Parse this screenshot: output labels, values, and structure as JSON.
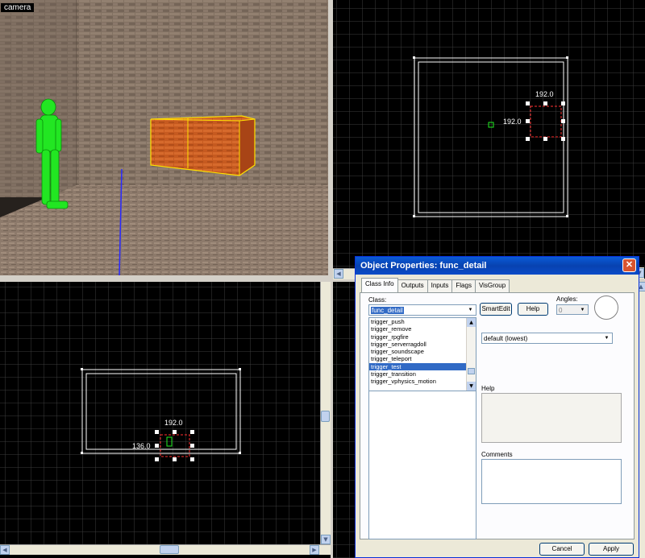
{
  "viewports": {
    "camera_label": "camera",
    "top_dims": {
      "width": "192.0",
      "height": "192.0"
    },
    "front_dims": {
      "width": "192.0",
      "height": "136.0"
    }
  },
  "dialog": {
    "title": "Object Properties: func_detail",
    "tabs": [
      "Class Info",
      "Outputs",
      "Inputs",
      "Flags",
      "VisGroup"
    ],
    "class_label": "Class:",
    "class_value": "func_detail",
    "class_list": [
      "trigger_push",
      "trigger_remove",
      "trigger_rpgfire",
      "trigger_serverragdoll",
      "trigger_soundscape",
      "trigger_teleport",
      "trigger_test",
      "trigger_transition",
      "trigger_vphysics_motion"
    ],
    "class_list_selected": "trigger_test",
    "smartedit_label": "SmartEdit",
    "help_button_label": "Help",
    "angles_label": "Angles:",
    "angles_value": "0",
    "property_value": "default (lowest)",
    "help_label": "Help",
    "comments_label": "Comments",
    "cancel_label": "Cancel",
    "apply_label": "Apply"
  },
  "colors": {
    "grid_line": "#4a4a4a",
    "grid_major": "#6b6b6b",
    "brush_outline": "#ffffff",
    "selection": "#ff3030",
    "figure": "#22ee22",
    "crate": "#c8551e"
  }
}
